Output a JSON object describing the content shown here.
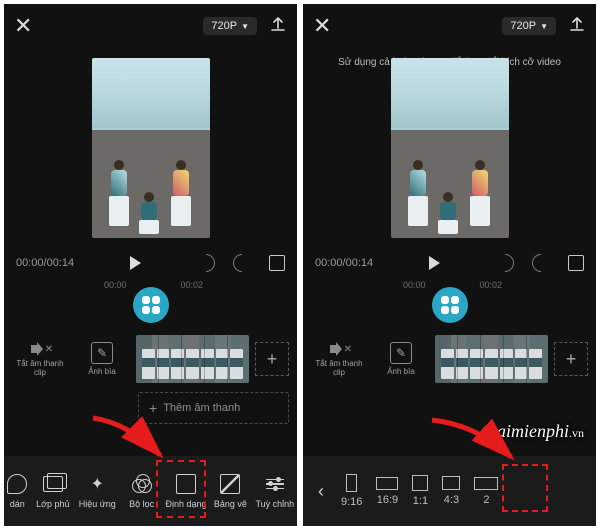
{
  "header": {
    "resolution": "720P",
    "close": "✕"
  },
  "hint_text": "Sử dụng cả hai ngón tay để thay đổi\nkích cỡ video",
  "time": {
    "current": "00:00",
    "total": "00:14",
    "sep": "/"
  },
  "ruler_ticks": [
    "00:00",
    "00:02"
  ],
  "track": {
    "mute_label": "Tắt âm thanh clip",
    "cover_label": "Ảnh bìa"
  },
  "audio_row": {
    "plus": "+",
    "label": "Thêm âm thanh"
  },
  "add_plus": "+",
  "toolbar": {
    "items": [
      {
        "key": "dan",
        "label": "dán"
      },
      {
        "key": "lopphu",
        "label": "Lớp phủ"
      },
      {
        "key": "hieuung",
        "label": "Hiệu ứng"
      },
      {
        "key": "boloc",
        "label": "Bộ lọc"
      },
      {
        "key": "dinhdang",
        "label": "Định dạng"
      },
      {
        "key": "bangve",
        "label": "Bảng vẽ"
      },
      {
        "key": "tuychinh",
        "label": "Tuỳ chỉnh"
      }
    ]
  },
  "ratios": {
    "back": "‹",
    "items": [
      {
        "key": "r916",
        "label": "9:16"
      },
      {
        "key": "r169",
        "label": "16:9"
      },
      {
        "key": "r11",
        "label": "1:1"
      },
      {
        "key": "r43",
        "label": "4:3"
      },
      {
        "key": "r21",
        "label": "2"
      }
    ]
  },
  "watermark": {
    "text": "aimienphi",
    "suffix": ".vn"
  }
}
